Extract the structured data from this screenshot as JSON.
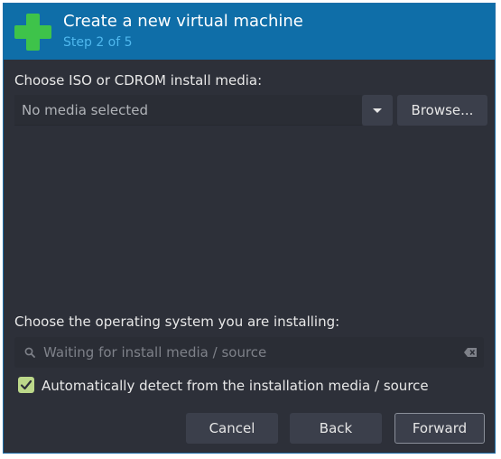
{
  "header": {
    "title": "Create a new virtual machine",
    "step": "Step 2 of 5"
  },
  "install_media": {
    "label": "Choose ISO or CDROM install media:",
    "selected_value": "No media selected",
    "browse_label": "Browse..."
  },
  "os_section": {
    "label": "Choose the operating system you are installing:",
    "search_placeholder": "Waiting for install media / source",
    "search_value": "",
    "auto_detect_label": "Automatically detect from the installation media / source",
    "auto_detect_checked": true
  },
  "footer": {
    "cancel_label": "Cancel",
    "back_label": "Back",
    "forward_label": "Forward"
  },
  "icons": {
    "app": "plus-icon",
    "dropdown": "chevron-down-icon",
    "search": "search-icon",
    "clear": "clear-icon",
    "checkbox": "check-icon"
  },
  "colors": {
    "header_bg": "#0f6ea8",
    "step_text": "#4fb8ee",
    "plus_green": "#3ec34a",
    "window_bg": "#2d3039",
    "button_bg": "#3b3f4b",
    "checkbox_bg": "#bcd88a"
  }
}
